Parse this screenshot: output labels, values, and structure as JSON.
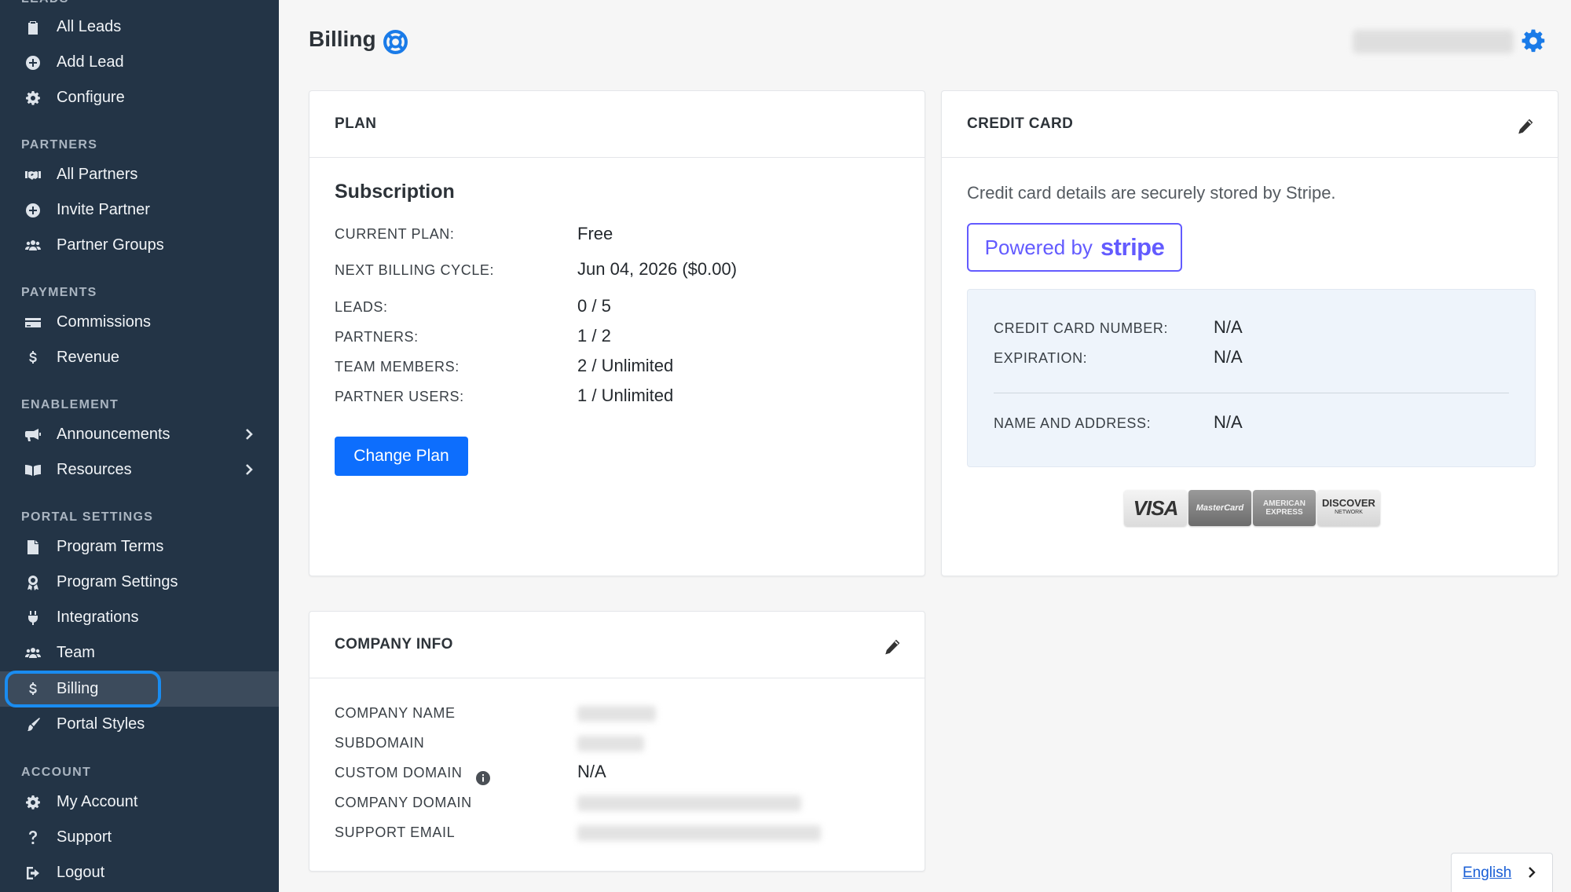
{
  "sidebar": {
    "top_section": "LEADS",
    "sections": {
      "partners": "PARTNERS",
      "payments": "PAYMENTS",
      "enablement": "ENABLEMENT",
      "portal_settings": "PORTAL SETTINGS",
      "account": "ACCOUNT"
    },
    "items": {
      "all_leads": "All Leads",
      "add_lead": "Add Lead",
      "configure": "Configure",
      "all_partners": "All Partners",
      "invite_partner": "Invite Partner",
      "partner_groups": "Partner Groups",
      "commissions": "Commissions",
      "revenue": "Revenue",
      "announcements": "Announcements",
      "resources": "Resources",
      "program_terms": "Program Terms",
      "program_settings": "Program Settings",
      "integrations": "Integrations",
      "team": "Team",
      "billing": "Billing",
      "portal_styles": "Portal Styles",
      "my_account": "My Account",
      "support": "Support",
      "logout": "Logout"
    },
    "active_item": "billing",
    "colors": {
      "background": "#233446",
      "active_bg": "#3c4b5c",
      "focus_ring": "#1a8cf0"
    }
  },
  "header": {
    "title": "Billing"
  },
  "plan": {
    "heading": "PLAN",
    "subscription_title": "Subscription",
    "rows": [
      {
        "label": "CURRENT PLAN:",
        "value": "Free"
      },
      {
        "label": "NEXT BILLING CYCLE:",
        "value": "Jun 04, 2026 ($0.00)"
      },
      {
        "label": "LEADS:",
        "value": "0 / 5"
      },
      {
        "label": "PARTNERS:",
        "value": "1 / 2"
      },
      {
        "label": "TEAM MEMBERS:",
        "value": "2 / Unlimited"
      },
      {
        "label": "PARTNER USERS:",
        "value": "1 / Unlimited"
      }
    ],
    "change_plan_label": "Change Plan"
  },
  "credit_card": {
    "heading": "CREDIT CARD",
    "description": "Credit card details are securely stored by Stripe.",
    "powered_by": "Powered by",
    "stripe": "stripe",
    "rows": [
      {
        "label": "CREDIT CARD NUMBER:",
        "value": "N/A"
      },
      {
        "label": "EXPIRATION:",
        "value": "N/A"
      },
      {
        "label": "NAME AND ADDRESS:",
        "value": "N/A"
      }
    ],
    "card_logos": {
      "visa": "VISA",
      "mastercard": "MasterCard",
      "amex": "AMERICAN EXPRESS",
      "discover": "DISCOVER",
      "discover_sub": "NETWORK"
    },
    "stripe_color": "#635bff"
  },
  "company_info": {
    "heading": "COMPANY INFO",
    "rows": [
      {
        "label": "COMPANY NAME",
        "value": ""
      },
      {
        "label": "SUBDOMAIN",
        "value": ""
      },
      {
        "label": "CUSTOM DOMAIN",
        "value": "N/A"
      },
      {
        "label": "COMPANY DOMAIN",
        "value": ""
      },
      {
        "label": "SUPPORT EMAIL",
        "value": ""
      }
    ]
  },
  "language": {
    "current": "English"
  },
  "accent_color": "#0d6efd"
}
